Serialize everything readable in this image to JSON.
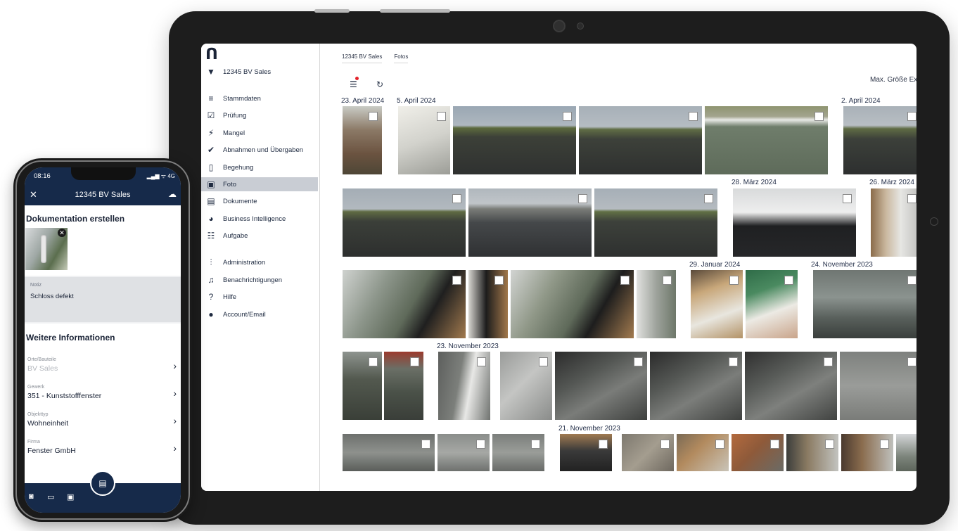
{
  "tablet": {
    "project": "12345 BV Sales",
    "nav": [
      {
        "label": "Stammdaten",
        "icon": "database-icon",
        "glyph": "≡"
      },
      {
        "label": "Prüfung",
        "icon": "checkbox-icon",
        "glyph": "☑"
      },
      {
        "label": "Mangel",
        "icon": "lightning-icon",
        "glyph": "⚡"
      },
      {
        "label": "Abnahmen und Übergaben",
        "icon": "pen-check-icon",
        "glyph": "✔"
      },
      {
        "label": "Begehung",
        "icon": "clipboard-icon",
        "glyph": "▯"
      },
      {
        "label": "Foto",
        "icon": "image-icon",
        "glyph": "▣"
      },
      {
        "label": "Dokumente",
        "icon": "documents-icon",
        "glyph": "▤"
      },
      {
        "label": "Business Intelligence",
        "icon": "pie-chart-icon",
        "glyph": "◕"
      },
      {
        "label": "Aufgabe",
        "icon": "task-list-icon",
        "glyph": "☷"
      },
      {
        "label": "Administration",
        "icon": "sliders-icon",
        "glyph": "⫶"
      },
      {
        "label": "Benachrichtigungen",
        "icon": "bell-icon",
        "glyph": "♫"
      },
      {
        "label": "Hilfe",
        "icon": "help-icon",
        "glyph": "?"
      },
      {
        "label": "Account/Email",
        "icon": "user-icon",
        "glyph": "●"
      }
    ],
    "active_nav": "Foto",
    "breadcrumb": [
      "12345 BV Sales",
      "Fotos"
    ],
    "max_size_label": "Max. Größe Exp",
    "dates": [
      "23. April 2024",
      "5. April 2024",
      "2. April 2024",
      "28. März 2024",
      "26. März 2024",
      "29. Januar 2024",
      "24. November 2023",
      "23. November 2023",
      "21. November 2023"
    ]
  },
  "phone": {
    "time": "08:16",
    "signal": "▂▄▆ ᯤ 4G",
    "title": "12345 BV Sales",
    "doc_heading": "Dokumentation erstellen",
    "note_label": "Notiz",
    "note_value": "Schloss defekt",
    "info_heading": "Weitere Informationen",
    "rows": [
      {
        "label": "Orte/Bauteile",
        "value": "BV Sales"
      },
      {
        "label": "Gewerk",
        "value": "351 - Kunststofffenster"
      },
      {
        "label": "Objekttyp",
        "value": "Wohneinheit"
      },
      {
        "label": "Firma",
        "value": "Fenster GmbH"
      }
    ]
  }
}
